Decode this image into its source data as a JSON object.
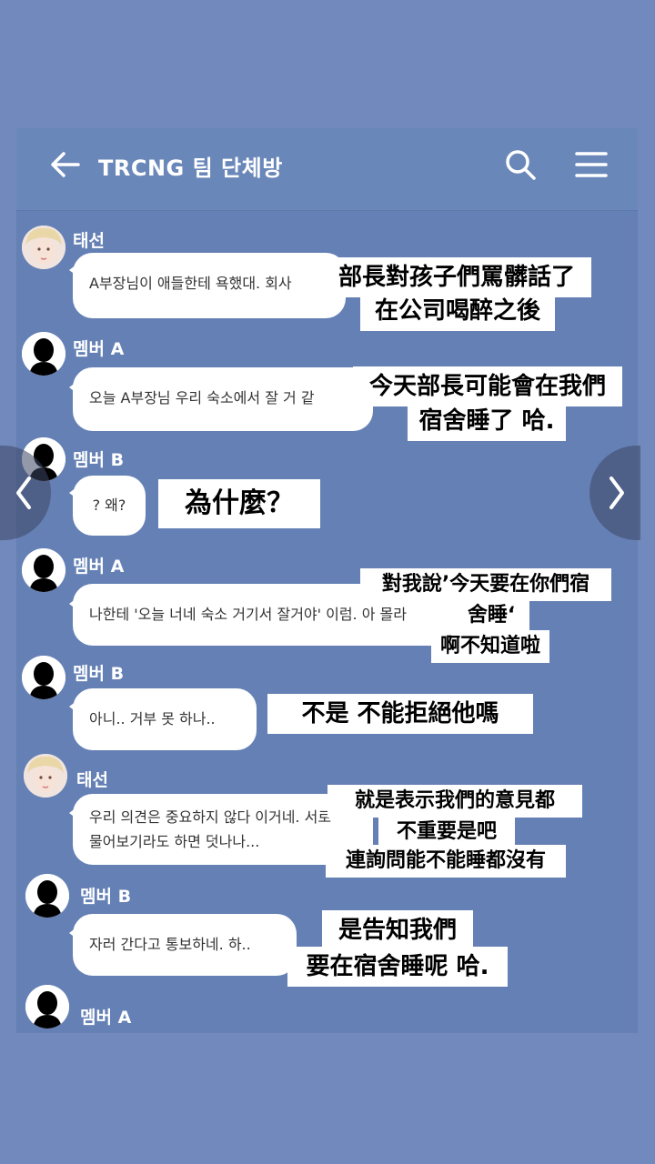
{
  "header": {
    "title": "TRCNG 팀 단체방"
  },
  "icons": {
    "back": "back-arrow-icon",
    "search": "search-icon",
    "menu": "hamburger-menu-icon",
    "prev": "chevron-left-icon",
    "next": "chevron-right-icon"
  },
  "messages": [
    {
      "sender": "태선",
      "text": "A부장님이 애들한테 욕했대. 회사",
      "captions": [
        "部長對孩子們罵髒話了",
        "在公司喝醉之後"
      ]
    },
    {
      "sender": "멤버 A",
      "text": "오늘 A부장님 우리 숙소에서 잘 거 같",
      "captions": [
        "今天部長可能會在我們",
        "宿舍睡了 哈."
      ]
    },
    {
      "sender": "멤버 B",
      "text": "? 왜?",
      "captions": [
        "為什麼？"
      ]
    },
    {
      "sender": "멤버 A",
      "text": "나한테 '오늘 너네 숙소 거기서 잘거야' 이럼. 아 몰라",
      "captions": [
        "對我說’今天要在你們宿",
        "舍睡‘",
        "啊不知道啦"
      ]
    },
    {
      "sender": "멤버 B",
      "text": "아니.. 거부 못 하나..",
      "captions": [
        "不是 不能拒絕他嗎"
      ]
    },
    {
      "sender": "태선",
      "text_line1": "우리 의견은 중요하지 않다 이거네. 서로",
      "text_line2": "물어보기라도 하면 덧나나...",
      "captions": [
        "就是表示我們的意見都",
        "不重要是吧",
        "連詢問能不能睡都沒有"
      ]
    },
    {
      "sender": "멤버 B",
      "text": "자러 간다고 통보하네. 하..",
      "captions": [
        "是告知我們",
        "要在宿舍睡呢 哈."
      ]
    },
    {
      "sender": "멤버 A"
    }
  ]
}
